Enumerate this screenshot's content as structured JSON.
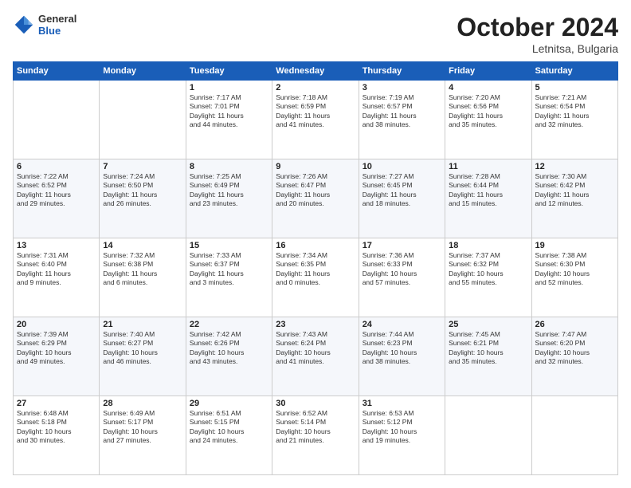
{
  "header": {
    "logo": {
      "general": "General",
      "blue": "Blue"
    },
    "title": "October 2024",
    "location": "Letnitsa, Bulgaria"
  },
  "weekdays": [
    "Sunday",
    "Monday",
    "Tuesday",
    "Wednesday",
    "Thursday",
    "Friday",
    "Saturday"
  ],
  "weeks": [
    [
      {
        "day": "",
        "info": ""
      },
      {
        "day": "",
        "info": ""
      },
      {
        "day": "1",
        "info": "Sunrise: 7:17 AM\nSunset: 7:01 PM\nDaylight: 11 hours\nand 44 minutes."
      },
      {
        "day": "2",
        "info": "Sunrise: 7:18 AM\nSunset: 6:59 PM\nDaylight: 11 hours\nand 41 minutes."
      },
      {
        "day": "3",
        "info": "Sunrise: 7:19 AM\nSunset: 6:57 PM\nDaylight: 11 hours\nand 38 minutes."
      },
      {
        "day": "4",
        "info": "Sunrise: 7:20 AM\nSunset: 6:56 PM\nDaylight: 11 hours\nand 35 minutes."
      },
      {
        "day": "5",
        "info": "Sunrise: 7:21 AM\nSunset: 6:54 PM\nDaylight: 11 hours\nand 32 minutes."
      }
    ],
    [
      {
        "day": "6",
        "info": "Sunrise: 7:22 AM\nSunset: 6:52 PM\nDaylight: 11 hours\nand 29 minutes."
      },
      {
        "day": "7",
        "info": "Sunrise: 7:24 AM\nSunset: 6:50 PM\nDaylight: 11 hours\nand 26 minutes."
      },
      {
        "day": "8",
        "info": "Sunrise: 7:25 AM\nSunset: 6:49 PM\nDaylight: 11 hours\nand 23 minutes."
      },
      {
        "day": "9",
        "info": "Sunrise: 7:26 AM\nSunset: 6:47 PM\nDaylight: 11 hours\nand 20 minutes."
      },
      {
        "day": "10",
        "info": "Sunrise: 7:27 AM\nSunset: 6:45 PM\nDaylight: 11 hours\nand 18 minutes."
      },
      {
        "day": "11",
        "info": "Sunrise: 7:28 AM\nSunset: 6:44 PM\nDaylight: 11 hours\nand 15 minutes."
      },
      {
        "day": "12",
        "info": "Sunrise: 7:30 AM\nSunset: 6:42 PM\nDaylight: 11 hours\nand 12 minutes."
      }
    ],
    [
      {
        "day": "13",
        "info": "Sunrise: 7:31 AM\nSunset: 6:40 PM\nDaylight: 11 hours\nand 9 minutes."
      },
      {
        "day": "14",
        "info": "Sunrise: 7:32 AM\nSunset: 6:38 PM\nDaylight: 11 hours\nand 6 minutes."
      },
      {
        "day": "15",
        "info": "Sunrise: 7:33 AM\nSunset: 6:37 PM\nDaylight: 11 hours\nand 3 minutes."
      },
      {
        "day": "16",
        "info": "Sunrise: 7:34 AM\nSunset: 6:35 PM\nDaylight: 11 hours\nand 0 minutes."
      },
      {
        "day": "17",
        "info": "Sunrise: 7:36 AM\nSunset: 6:33 PM\nDaylight: 10 hours\nand 57 minutes."
      },
      {
        "day": "18",
        "info": "Sunrise: 7:37 AM\nSunset: 6:32 PM\nDaylight: 10 hours\nand 55 minutes."
      },
      {
        "day": "19",
        "info": "Sunrise: 7:38 AM\nSunset: 6:30 PM\nDaylight: 10 hours\nand 52 minutes."
      }
    ],
    [
      {
        "day": "20",
        "info": "Sunrise: 7:39 AM\nSunset: 6:29 PM\nDaylight: 10 hours\nand 49 minutes."
      },
      {
        "day": "21",
        "info": "Sunrise: 7:40 AM\nSunset: 6:27 PM\nDaylight: 10 hours\nand 46 minutes."
      },
      {
        "day": "22",
        "info": "Sunrise: 7:42 AM\nSunset: 6:26 PM\nDaylight: 10 hours\nand 43 minutes."
      },
      {
        "day": "23",
        "info": "Sunrise: 7:43 AM\nSunset: 6:24 PM\nDaylight: 10 hours\nand 41 minutes."
      },
      {
        "day": "24",
        "info": "Sunrise: 7:44 AM\nSunset: 6:23 PM\nDaylight: 10 hours\nand 38 minutes."
      },
      {
        "day": "25",
        "info": "Sunrise: 7:45 AM\nSunset: 6:21 PM\nDaylight: 10 hours\nand 35 minutes."
      },
      {
        "day": "26",
        "info": "Sunrise: 7:47 AM\nSunset: 6:20 PM\nDaylight: 10 hours\nand 32 minutes."
      }
    ],
    [
      {
        "day": "27",
        "info": "Sunrise: 6:48 AM\nSunset: 5:18 PM\nDaylight: 10 hours\nand 30 minutes."
      },
      {
        "day": "28",
        "info": "Sunrise: 6:49 AM\nSunset: 5:17 PM\nDaylight: 10 hours\nand 27 minutes."
      },
      {
        "day": "29",
        "info": "Sunrise: 6:51 AM\nSunset: 5:15 PM\nDaylight: 10 hours\nand 24 minutes."
      },
      {
        "day": "30",
        "info": "Sunrise: 6:52 AM\nSunset: 5:14 PM\nDaylight: 10 hours\nand 21 minutes."
      },
      {
        "day": "31",
        "info": "Sunrise: 6:53 AM\nSunset: 5:12 PM\nDaylight: 10 hours\nand 19 minutes."
      },
      {
        "day": "",
        "info": ""
      },
      {
        "day": "",
        "info": ""
      }
    ]
  ]
}
